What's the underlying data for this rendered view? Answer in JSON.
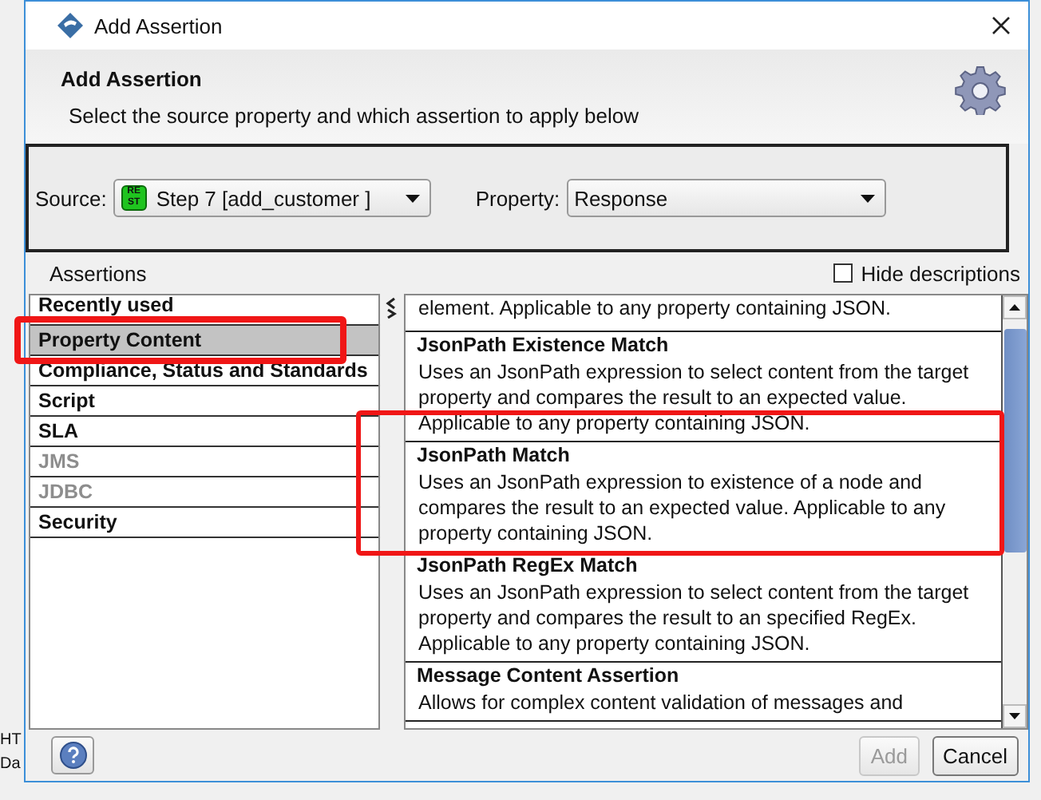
{
  "window": {
    "title": "Add Assertion"
  },
  "header": {
    "title": "Add Assertion",
    "subtitle": "Select the source property and which assertion to apply below"
  },
  "source": {
    "label": "Source:",
    "value": "Step 7 [add_customer ]",
    "badge": "RE ST"
  },
  "property": {
    "label": "Property:",
    "value": "Response"
  },
  "assertions_label": "Assertions",
  "hide_descriptions": {
    "label": "Hide descriptions",
    "checked": false
  },
  "categories": [
    {
      "label": "Recently used",
      "selected": false,
      "disabled": false
    },
    {
      "label": "Property Content",
      "selected": true,
      "disabled": false
    },
    {
      "label": "Compliance, Status and Standards",
      "selected": false,
      "disabled": false
    },
    {
      "label": "Script",
      "selected": false,
      "disabled": false
    },
    {
      "label": "SLA",
      "selected": false,
      "disabled": false
    },
    {
      "label": "JMS",
      "selected": false,
      "disabled": true
    },
    {
      "label": "JDBC",
      "selected": false,
      "disabled": true
    },
    {
      "label": "Security",
      "selected": false,
      "disabled": false
    }
  ],
  "assertions": [
    {
      "description": "element. Applicable to any property containing JSON."
    },
    {
      "name": "JsonPath Existence Match",
      "description": "Uses an JsonPath expression to select content from the target property and compares the result to an expected value. Applicable to any property containing JSON."
    },
    {
      "name": "JsonPath Match",
      "description": "Uses an JsonPath expression to existence of a node and compares the result to an expected value. Applicable to any property containing JSON."
    },
    {
      "name": "JsonPath RegEx Match",
      "description": "Uses an JsonPath expression to select content from the target property and compares the result to an specified RegEx. Applicable to any property containing JSON."
    },
    {
      "name": "Message Content Assertion",
      "description": "Allows for complex content validation of messages and"
    }
  ],
  "buttons": {
    "add": {
      "label": "Add",
      "disabled": true
    },
    "cancel": {
      "label": "Cancel",
      "disabled": false
    }
  },
  "background_texts": [
    "HT",
    "Da"
  ]
}
